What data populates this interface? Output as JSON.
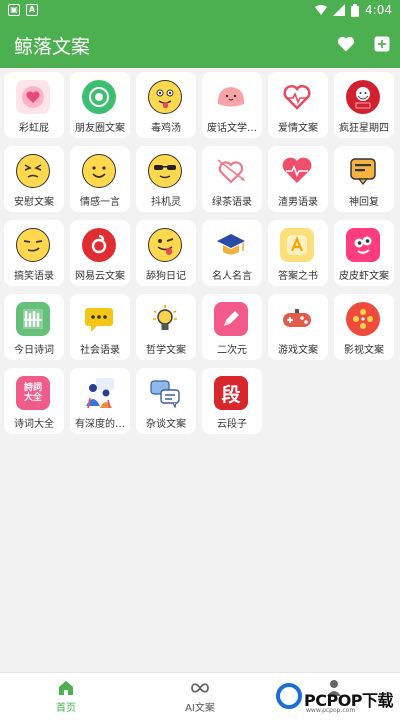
{
  "status_bar": {
    "time": "4:04",
    "left_icons": [
      "gallery-notification-icon",
      "a-notification-icon"
    ],
    "right_icons": [
      "wifi-icon",
      "signal-icon",
      "battery-icon"
    ]
  },
  "app_bar": {
    "title": "鲸落文案",
    "actions": [
      "heart-icon",
      "add-square-icon"
    ]
  },
  "colors": {
    "primary": "#4caf50",
    "background": "#f2f2f2",
    "tile": "#ffffff"
  },
  "categories": [
    {
      "label": "彩虹屁",
      "icon": "pink-heart-icon"
    },
    {
      "label": "朋友圈文案",
      "icon": "green-aperture-icon"
    },
    {
      "label": "毒鸡汤",
      "icon": "tongue-face-icon"
    },
    {
      "label": "废话文学…",
      "icon": "pink-blob-icon"
    },
    {
      "label": "爱情文案",
      "icon": "heart-pulse-icon"
    },
    {
      "label": "疯狂星期四",
      "icon": "kfc-logo-icon"
    },
    {
      "label": "安慰文案",
      "icon": "squint-face-icon"
    },
    {
      "label": "情感一言",
      "icon": "smile-face-icon"
    },
    {
      "label": "抖机灵",
      "icon": "sunglasses-face-icon"
    },
    {
      "label": "绿茶语录",
      "icon": "arrow-heart-icon"
    },
    {
      "label": "渣男语录",
      "icon": "heartbeat-icon"
    },
    {
      "label": "神回复",
      "icon": "chat-bubble-icon"
    },
    {
      "label": "搞笑语录",
      "icon": "smirk-face-icon"
    },
    {
      "label": "网易云文案",
      "icon": "netease-music-icon"
    },
    {
      "label": "舔狗日记",
      "icon": "wink-tongue-face-icon"
    },
    {
      "label": "名人名言",
      "icon": "graduation-cap-icon"
    },
    {
      "label": "答案之书",
      "icon": "answer-book-icon"
    },
    {
      "label": "皮皮虾文案",
      "icon": "pipixia-icon"
    },
    {
      "label": "今日诗词",
      "icon": "poetry-icon"
    },
    {
      "label": "社会语录",
      "icon": "message-icon"
    },
    {
      "label": "哲学文案",
      "icon": "lightbulb-icon"
    },
    {
      "label": "二次元",
      "icon": "pencil-icon"
    },
    {
      "label": "游戏文案",
      "icon": "gamepad-icon"
    },
    {
      "label": "影视文案",
      "icon": "film-reel-icon"
    },
    {
      "label": "诗词大全",
      "icon": "poetry-collection-icon",
      "icon_text": "詩詞大全"
    },
    {
      "label": "有深度的…",
      "icon": "people-thinking-icon"
    },
    {
      "label": "杂谈文案",
      "icon": "chat-bubbles-icon"
    },
    {
      "label": "云段子",
      "icon": "duan-icon",
      "icon_text": "段"
    }
  ],
  "bottom_nav": [
    {
      "label": "首页",
      "icon": "home-icon",
      "active": true
    },
    {
      "label": "AI文案",
      "icon": "infinity-icon",
      "active": false
    },
    {
      "label": "",
      "icon": "person-icon",
      "active": false
    }
  ],
  "watermark": {
    "text": "PCPOP下载",
    "sub": "www.pcpop.com"
  }
}
